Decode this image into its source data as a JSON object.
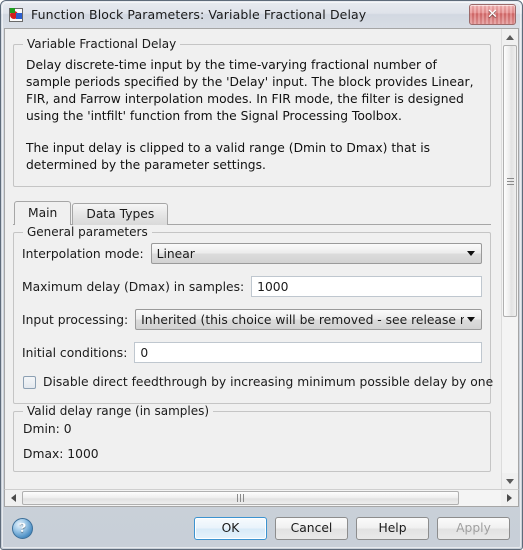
{
  "window": {
    "title": "Function Block Parameters: Variable Fractional Delay",
    "icon": "simulink-block-icon",
    "close_label": "✕"
  },
  "description": {
    "group_title": "Variable Fractional Delay",
    "paragraphs": [
      "Delay discrete-time input by the time-varying fractional number of sample periods specified by the 'Delay' input. The block provides Linear, FIR, and Farrow interpolation modes. In FIR mode, the filter is designed using the 'intfilt' function from the Signal Processing Toolbox.",
      "The input delay is clipped to a valid range (Dmin to Dmax) that is determined by the parameter settings."
    ]
  },
  "tabs": [
    {
      "label": "Main",
      "active": true
    },
    {
      "label": "Data Types",
      "active": false
    }
  ],
  "main_tab": {
    "general_group": {
      "title": "General parameters",
      "interpolation_mode": {
        "label": "Interpolation mode:",
        "value": "Linear"
      },
      "maximum_delay": {
        "label": "Maximum delay (Dmax) in samples:",
        "value": "1000"
      },
      "input_processing": {
        "label": "Input processing:",
        "value": "Inherited (this choice will be removed - see release notes)"
      },
      "initial_conditions": {
        "label": "Initial conditions:",
        "value": "0"
      },
      "disable_feedthrough": {
        "label": "Disable direct feedthrough by increasing minimum possible delay by one",
        "checked": false
      }
    },
    "valid_range_group": {
      "title": "Valid delay range (in samples)",
      "dmin": "Dmin: 0",
      "dmax": "Dmax: 1000"
    }
  },
  "footer": {
    "help_orb": "?",
    "buttons": [
      {
        "label": "OK",
        "state": "default"
      },
      {
        "label": "Cancel",
        "state": "normal"
      },
      {
        "label": "Help",
        "state": "normal"
      },
      {
        "label": "Apply",
        "state": "disabled"
      }
    ]
  },
  "colors": {
    "dialog_bg": "#f0f0f0",
    "frame": "#5e6b7a",
    "close_red": "#e88d8d",
    "default_button_border": "#3c93d0",
    "disabled_text": "#a0a0a0"
  }
}
